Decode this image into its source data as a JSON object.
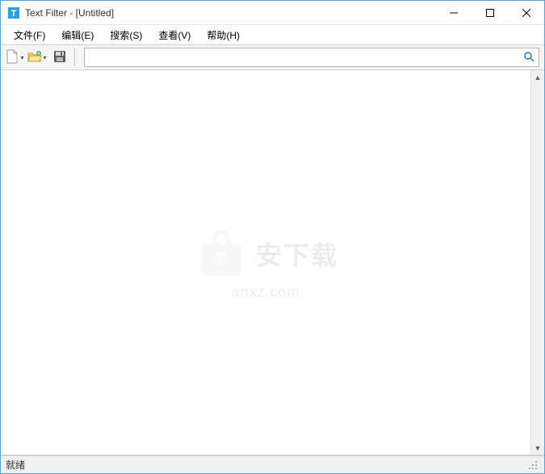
{
  "window": {
    "title": "Text Filter - [Untitled]"
  },
  "menu": {
    "file": "文件(F)",
    "edit": "编辑(E)",
    "search": "搜索(S)",
    "view": "查看(V)",
    "help": "帮助(H)"
  },
  "toolbar": {
    "new_label": "New",
    "open_label": "Open",
    "save_label": "Save"
  },
  "search": {
    "value": "",
    "placeholder": ""
  },
  "statusbar": {
    "ready": "就绪"
  },
  "watermark": {
    "cn": "安下载",
    "en": "anxz.com"
  }
}
